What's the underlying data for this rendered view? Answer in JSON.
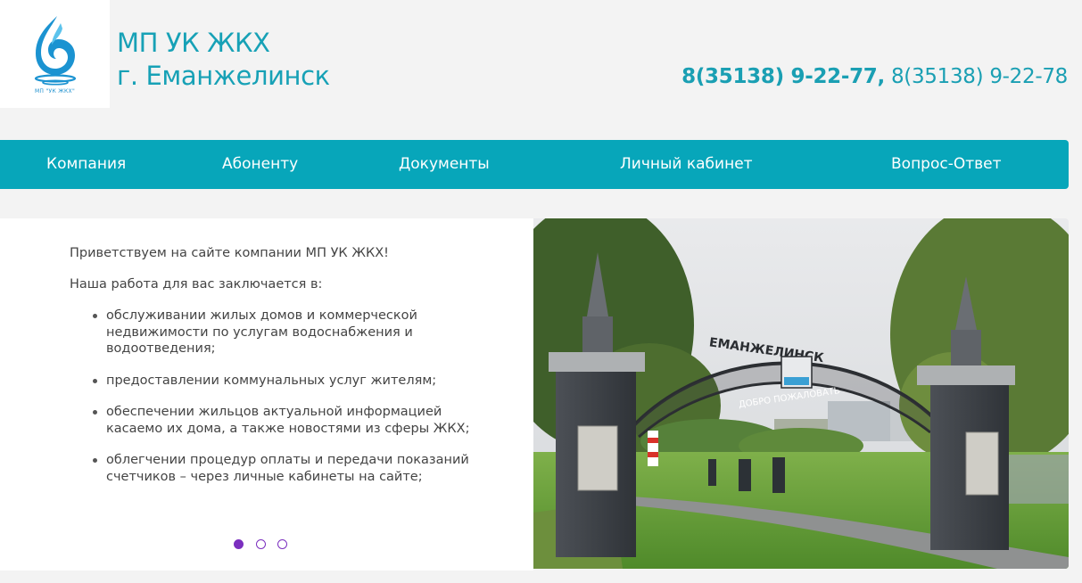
{
  "header": {
    "logo_caption": "МП \"УК ЖКХ\"",
    "title_line1": "МП УК ЖКХ",
    "title_line2": "г. Еманжелинск",
    "phone1": "8(35138) 9-22-77,",
    "phone2": "8(35138) 9-22-78"
  },
  "nav": {
    "items": [
      {
        "label": "Компания"
      },
      {
        "label": "Абоненту"
      },
      {
        "label": "Документы"
      },
      {
        "label": "Личный кабинет"
      },
      {
        "label": "Вопрос-Ответ"
      }
    ]
  },
  "slide": {
    "greeting": "Приветствуем на сайте компании МП УК ЖКХ!",
    "lead": "Наша работа для вас заключается в:",
    "bullets": [
      "обслуживании жилых домов и коммерческой недвижимости по услугам водоснабжения и водоотведения;",
      "предоставлении коммунальных услуг жителям;",
      "обеспечении жильцов актуальной информацией касаемо их дома, а также новостями из сферы ЖКХ;",
      "облегчении процедур оплаты и передачи показаний счетчиков – через личные кабинеты на сайте;"
    ],
    "active_slide": 1,
    "slide_count": 3
  },
  "photo": {
    "arch_text": "ЕМАНЖЕЛИНСК",
    "arch_subtext": "ДОБРО ПОЖАЛОВАТЬ"
  },
  "colors": {
    "accent": "#07a6ba",
    "brand_text": "#17a1b6",
    "dot": "#7b2fbf",
    "background": "#f3f3f3"
  }
}
